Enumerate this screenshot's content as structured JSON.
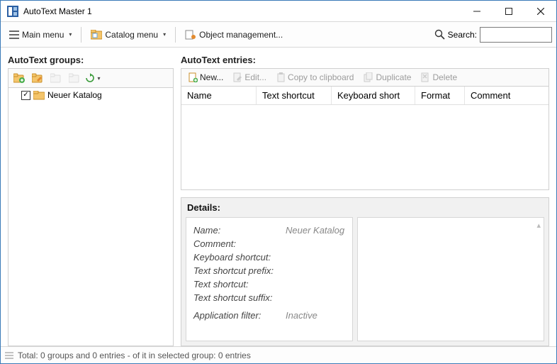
{
  "window": {
    "title": "AutoText Master 1"
  },
  "toolbar": {
    "main_menu": "Main menu",
    "catalog_menu": "Catalog menu",
    "object_mgmt": "Object management...",
    "search_label": "Search:",
    "search_value": ""
  },
  "left_panel": {
    "title": "AutoText groups:",
    "tree": {
      "item0": {
        "label": "Neuer Katalog",
        "checked": true
      }
    }
  },
  "entries_panel": {
    "title": "AutoText entries:",
    "toolbar": {
      "new": "New...",
      "edit": "Edit...",
      "copy": "Copy to clipboard",
      "duplicate": "Duplicate",
      "delete": "Delete"
    },
    "columns": {
      "name": "Name",
      "text_shortcut": "Text shortcut",
      "keyboard_short": "Keyboard short",
      "format": "Format",
      "comment": "Comment"
    }
  },
  "details": {
    "title": "Details:",
    "keys": {
      "name": "Name:",
      "comment": "Comment:",
      "kbd": "Keyboard shortcut:",
      "ts_prefix": "Text shortcut prefix:",
      "ts": "Text shortcut:",
      "ts_suffix": "Text shortcut suffix:",
      "app_filter": "Application filter:"
    },
    "values": {
      "name": "Neuer Katalog",
      "comment": "",
      "kbd": "",
      "ts_prefix": "",
      "ts": "",
      "ts_suffix": "",
      "app_filter": "Inactive"
    }
  },
  "statusbar": {
    "text": "Total: 0 groups and 0 entries - of it in selected group: 0 entries"
  }
}
